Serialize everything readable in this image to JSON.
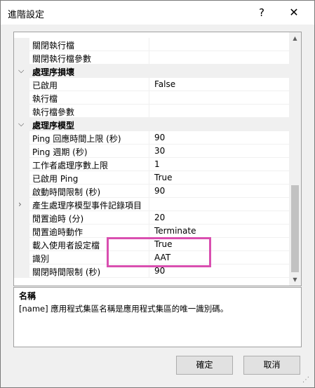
{
  "dialog": {
    "title": "進階設定",
    "help_glyph": "?",
    "close_glyph": "✕"
  },
  "grid": {
    "rows": [
      {
        "name": "關閉執行檔",
        "value": ""
      },
      {
        "name": "關閉執行檔參數",
        "value": ""
      },
      {
        "category": "處理序損壞",
        "expanded": true
      },
      {
        "name": "已啟用",
        "value": "False"
      },
      {
        "name": "執行檔",
        "value": ""
      },
      {
        "name": "執行檔參數",
        "value": ""
      },
      {
        "category": "處理序模型",
        "expanded": true
      },
      {
        "name": "Ping 回應時間上限 (秒)",
        "value": "90"
      },
      {
        "name": "Ping 週期 (秒)",
        "value": "30"
      },
      {
        "name": "工作者處理序數上限",
        "value": "1"
      },
      {
        "name": "已啟用 Ping",
        "value": "True"
      },
      {
        "name": "啟動時間限制 (秒)",
        "value": "90"
      },
      {
        "name": "產生處理序模型事件記錄項目",
        "value": "",
        "expandable": true
      },
      {
        "name": "閒置逾時 (分)",
        "value": "20"
      },
      {
        "name": "閒置逾時動作",
        "value": "Terminate"
      },
      {
        "name": "載入使用者設定檔",
        "value": "True"
      },
      {
        "name": "識別",
        "value": "AAT"
      },
      {
        "name": "關閉時間限制 (秒)",
        "value": "90"
      }
    ]
  },
  "description": {
    "title": "名稱",
    "text": "[name] 應用程式集區名稱是應用程式集區的唯一識別碼。"
  },
  "buttons": {
    "ok": "確定",
    "cancel": "取消"
  },
  "annotation": {
    "color": "#d94fb0"
  }
}
